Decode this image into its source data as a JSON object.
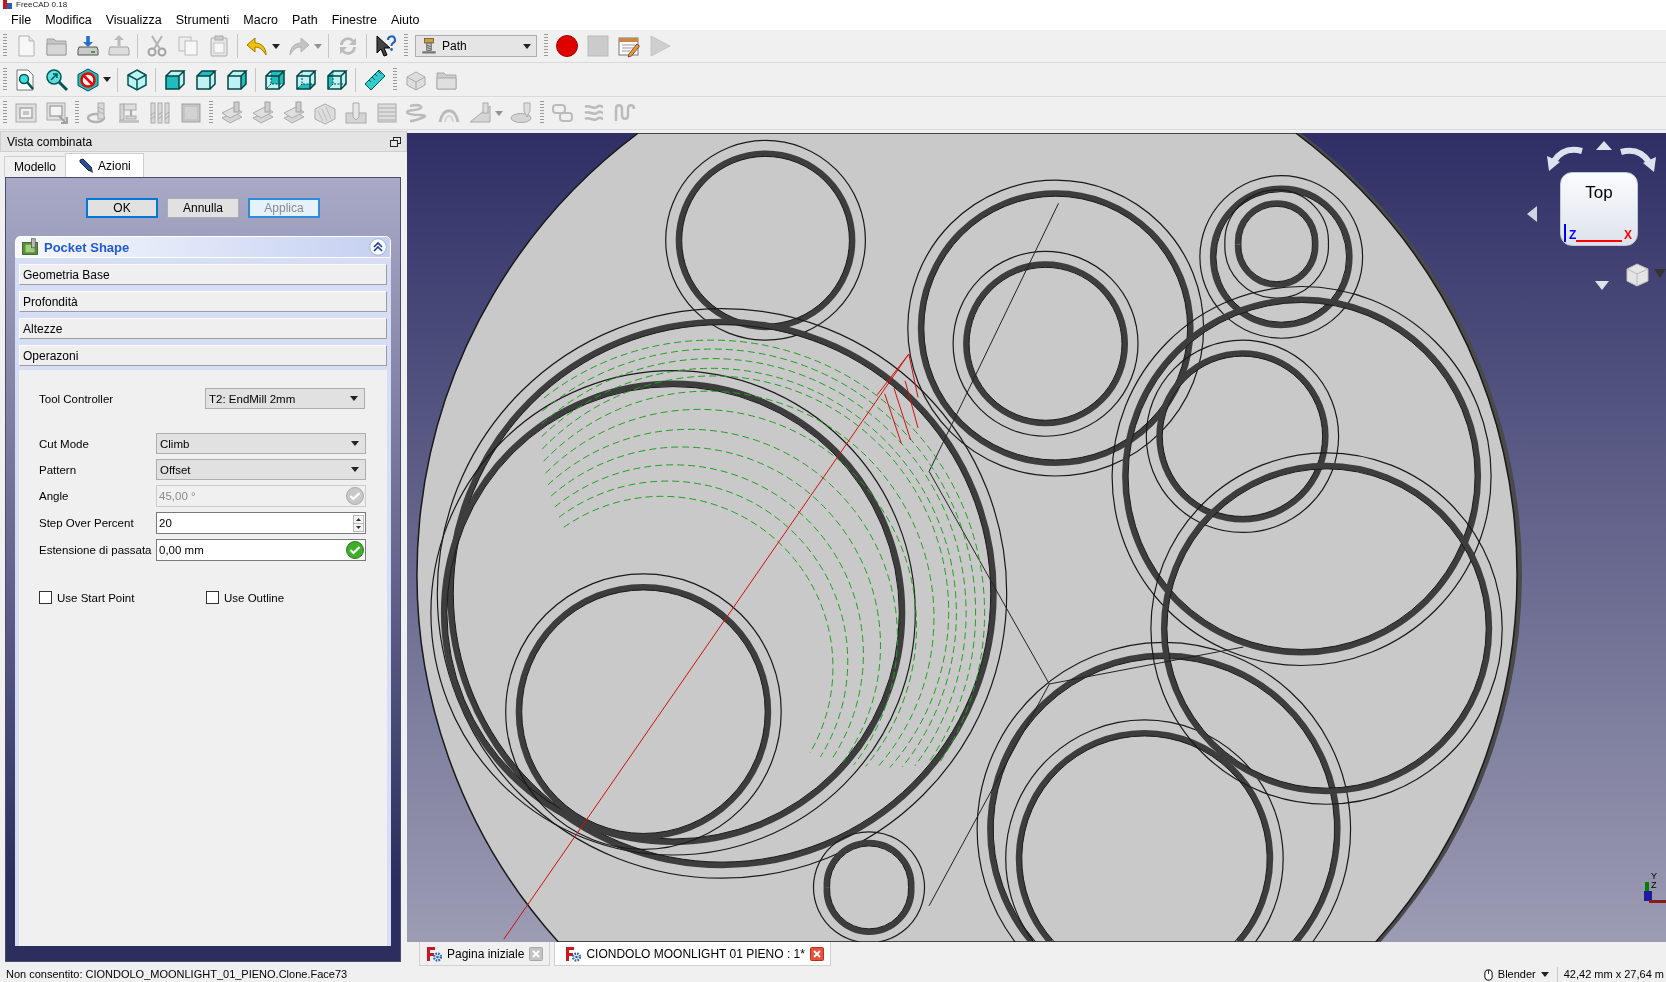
{
  "window": {
    "title": "FreeCAD 0.18"
  },
  "menu": [
    "File",
    "Modifica",
    "Visualizza",
    "Strumenti",
    "Macro",
    "Path",
    "Finestre",
    "Aiuto"
  ],
  "toolbar_rows": [
    {
      "toolbars": [
        {
          "groups": [
            [
              {
                "kind": "new",
                "disabled": true
              },
              {
                "kind": "open",
                "disabled": true
              },
              {
                "kind": "save",
                "disabled": false
              },
              {
                "kind": "saveas",
                "disabled": true
              }
            ],
            [
              {
                "kind": "cut",
                "disabled": true
              },
              {
                "kind": "copy",
                "disabled": true
              },
              {
                "kind": "paste",
                "disabled": true
              }
            ],
            [
              {
                "kind": "undo",
                "disabled": false
              },
              {
                "kind": "dropdown",
                "disabled": false
              },
              {
                "kind": "redo",
                "disabled": true
              },
              {
                "kind": "dropdown",
                "disabled": true
              }
            ],
            [
              {
                "kind": "refresh",
                "disabled": true
              }
            ],
            [
              {
                "kind": "whatsthis",
                "disabled": false
              }
            ]
          ]
        },
        {
          "groups": [
            [
              {
                "kind": "workbench",
                "value": "Path"
              }
            ]
          ]
        },
        {
          "groups": [
            [
              {
                "kind": "record",
                "disabled": false
              },
              {
                "kind": "stop",
                "disabled": true
              },
              {
                "kind": "editmacro",
                "disabled": false
              },
              {
                "kind": "play",
                "disabled": true
              }
            ]
          ]
        }
      ]
    },
    {
      "toolbars": [
        {
          "groups": [
            [
              {
                "kind": "fitall",
                "disabled": false
              },
              {
                "kind": "fitsel",
                "disabled": false
              },
              {
                "kind": "drawstyle",
                "disabled": false
              },
              {
                "kind": "dropdown",
                "disabled": false
              }
            ],
            [
              {
                "kind": "iso",
                "disabled": false
              }
            ],
            [
              {
                "kind": "front",
                "disabled": false
              },
              {
                "kind": "top",
                "disabled": false
              },
              {
                "kind": "right",
                "disabled": false
              }
            ],
            [
              {
                "kind": "rear",
                "disabled": false
              },
              {
                "kind": "bottom",
                "disabled": false
              },
              {
                "kind": "left",
                "disabled": false
              }
            ],
            [
              {
                "kind": "measure",
                "disabled": false
              }
            ]
          ]
        },
        {
          "groups": [
            [
              {
                "kind": "part",
                "disabled": true
              },
              {
                "kind": "group",
                "disabled": true
              }
            ]
          ]
        }
      ]
    },
    {
      "toolbars": [
        {
          "groups": [
            [
              {
                "kind": "job",
                "disabled": true
              },
              {
                "kind": "post",
                "disabled": true
              }
            ]
          ]
        },
        {
          "groups": [
            [
              {
                "kind": "toolcontroller",
                "disabled": true
              },
              {
                "kind": "tooltable",
                "disabled": true
              },
              {
                "kind": "toolbits",
                "disabled": true
              },
              {
                "kind": "toollib",
                "disabled": true
              }
            ]
          ]
        },
        {
          "groups": [
            [
              {
                "kind": "profile",
                "disabled": true
              },
              {
                "kind": "profile",
                "disabled": true
              },
              {
                "kind": "profile",
                "disabled": true
              },
              {
                "kind": "pocket3d",
                "disabled": true
              },
              {
                "kind": "drilling",
                "disabled": true
              },
              {
                "kind": "face",
                "disabled": true
              },
              {
                "kind": "helix",
                "disabled": true
              },
              {
                "kind": "engrave",
                "disabled": true
              },
              {
                "kind": "surface",
                "disabled": true
              },
              {
                "kind": "dropdown",
                "disabled": true
              },
              {
                "kind": "vcarve",
                "disabled": true
              }
            ]
          ]
        },
        {
          "groups": [
            [
              {
                "kind": "loops",
                "disabled": true
              },
              {
                "kind": "waves",
                "disabled": true
              },
              {
                "kind": "squiggle",
                "disabled": true
              }
            ]
          ]
        }
      ]
    }
  ],
  "combo_view": {
    "title": "Vista combinata",
    "tabs": [
      {
        "label": "Modello",
        "kind": "model",
        "selected": false
      },
      {
        "label": "Azioni",
        "kind": "tasks",
        "selected": true
      }
    ],
    "buttons": [
      {
        "label": "OK",
        "default": true,
        "disabled": false
      },
      {
        "label": "Annulla",
        "default": false,
        "disabled": false
      },
      {
        "label": "Applica",
        "default": false,
        "disabled": true
      }
    ],
    "task_box": {
      "title": "Pocket Shape",
      "expanded": true,
      "sections": [
        {
          "label": "Geometria Base"
        },
        {
          "label": "Profondità"
        },
        {
          "label": "Altezze"
        },
        {
          "label": "Operazoni",
          "options": {
            "tool_controller": {
              "label": "Tool Controller",
              "value": "T2: EndMill 2mm"
            },
            "fields": [
              {
                "label": "Cut Mode",
                "kind": "combo",
                "value": "Climb",
                "disabled": false
              },
              {
                "label": "Pattern",
                "kind": "combo",
                "value": "Offset",
                "disabled": false
              },
              {
                "label": "Angle",
                "kind": "quantity",
                "value": "45,00 °",
                "disabled": true
              },
              {
                "label": "Step Over Percent",
                "kind": "spin",
                "value": "20",
                "disabled": false
              },
              {
                "label": "Estensione di passata",
                "kind": "quantity",
                "value": "0,00 mm",
                "disabled": false
              }
            ],
            "checkboxes": [
              {
                "label": "Use Start Point",
                "checked": false
              },
              {
                "label": "Use Outline",
                "checked": false
              }
            ]
          }
        }
      ]
    }
  },
  "viewport": {
    "nav_cube": {
      "face": "Top",
      "axes": [
        {
          "label": "Z",
          "color": "#0000ff"
        },
        {
          "label": "X",
          "color": "#ff0000"
        }
      ]
    },
    "axis_triad": [
      {
        "label": "Y",
        "color": "#008000"
      },
      {
        "label": "Z",
        "color": "#1c1c9c"
      },
      {
        "color": "#8b1a1a"
      }
    ]
  },
  "document_tabs": [
    {
      "label": "Pagina iniziale",
      "selected": false
    },
    {
      "label": "CIONDOLO MOONLIGHT 01 PIENO : 1*",
      "selected": true
    }
  ],
  "status_bar": {
    "message": "Non consentito: CIONDOLO_MOONLIGHT_01_PIENO.Clone.Face73",
    "navigation": "Blender",
    "dimensions": "42,42 mm x 27,64 m"
  }
}
